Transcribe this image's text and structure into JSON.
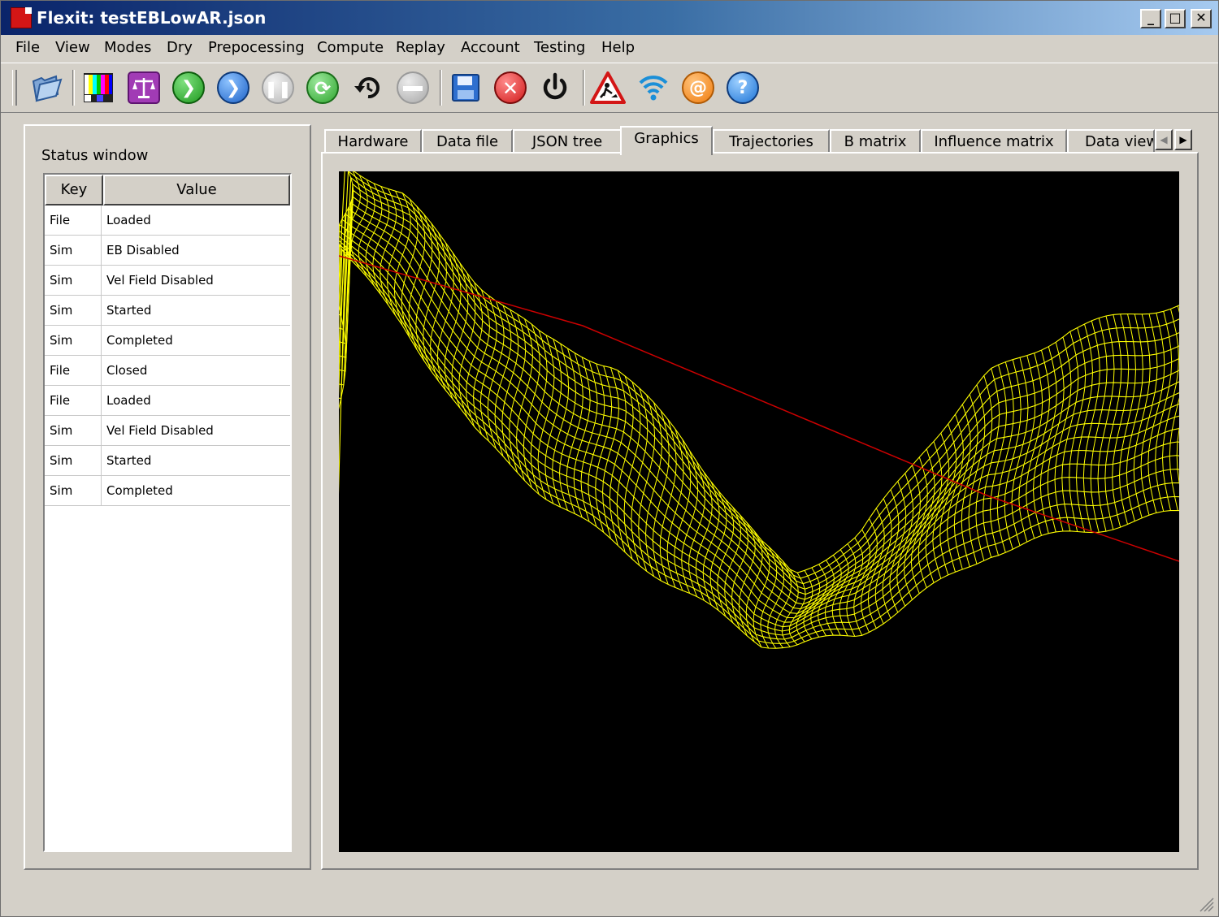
{
  "window": {
    "title": "Flexit: testEBLowAR.json",
    "controls": {
      "minimize": "_",
      "maximize": "□",
      "close": "✕"
    }
  },
  "menu": [
    "File",
    "View",
    "Modes",
    "Dry",
    "Prepocessing",
    "Compute",
    "Replay",
    "Account",
    "Testing",
    "Help"
  ],
  "toolbar": [
    "open-folder-icon",
    "color-bars-icon",
    "scales-icon",
    "run-green-icon",
    "step-blue-icon",
    "pause-icon",
    "refresh-icon",
    "replay-history-icon",
    "stop-gray-icon",
    "save-icon",
    "cancel-red-icon",
    "power-icon",
    "roadwork-warning-icon",
    "wifi-icon",
    "email-at-icon",
    "help-icon"
  ],
  "status": {
    "title": "Status window",
    "headers": {
      "key": "Key",
      "value": "Value"
    },
    "rows": [
      {
        "key": "File",
        "value": "Loaded"
      },
      {
        "key": "Sim",
        "value": "EB Disabled"
      },
      {
        "key": "Sim",
        "value": "Vel Field Disabled"
      },
      {
        "key": "Sim",
        "value": "Started"
      },
      {
        "key": "Sim",
        "value": "Completed"
      },
      {
        "key": "File",
        "value": "Closed"
      },
      {
        "key": "File",
        "value": "Loaded"
      },
      {
        "key": "Sim",
        "value": "Vel Field Disabled"
      },
      {
        "key": "Sim",
        "value": "Started"
      },
      {
        "key": "Sim",
        "value": "Completed"
      }
    ]
  },
  "tabs": [
    "Hardware",
    "Data file",
    "JSON tree",
    "Graphics",
    "Trajectories",
    "B matrix",
    "Influence matrix",
    "Data view"
  ],
  "active_tab": "Graphics",
  "colors": {
    "title_start": "#0a246a",
    "title_end": "#a6caf0",
    "face": "#d4d0c8",
    "viewport_bg": "#000000",
    "mesh": "#ffff00",
    "trajectory": "#cc0000"
  }
}
